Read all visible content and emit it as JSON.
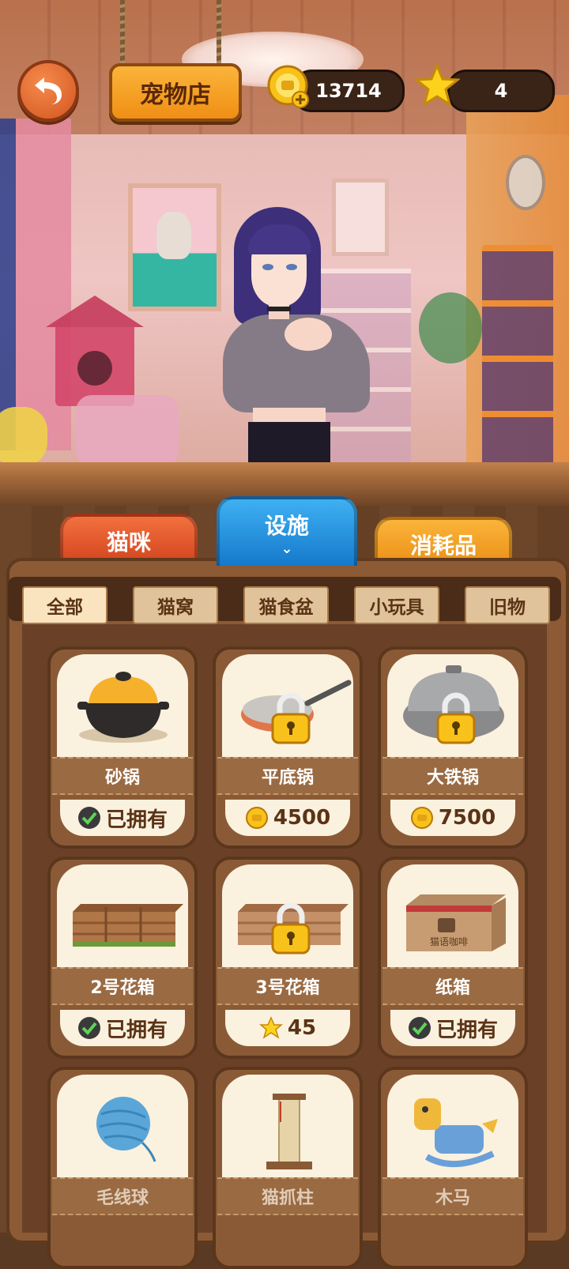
{
  "header": {
    "title": "宠物店",
    "coins": "13714",
    "stars": "4"
  },
  "tabs": {
    "cats": "猫咪",
    "facilities": "设施",
    "consumables": "消耗品",
    "active": "facilities"
  },
  "subtabs": [
    "全部",
    "猫窝",
    "猫食盆",
    "小玩具",
    "旧物"
  ],
  "items": [
    {
      "name": "砂锅",
      "status": "已拥有",
      "icon": "clay-pot-icon",
      "locked": false
    },
    {
      "name": "平底锅",
      "price": "4500",
      "currency": "coin",
      "icon": "frying-pan-icon",
      "locked": true
    },
    {
      "name": "大铁锅",
      "price": "7500",
      "currency": "coin",
      "icon": "iron-wok-icon",
      "locked": true
    },
    {
      "name": "2号花箱",
      "status": "已拥有",
      "icon": "planter-box-icon",
      "locked": false
    },
    {
      "name": "3号花箱",
      "price": "45",
      "currency": "star",
      "icon": "planter-box-icon",
      "locked": true
    },
    {
      "name": "纸箱",
      "status": "已拥有",
      "icon": "cardboard-box-icon",
      "locked": false,
      "box_text": "猫语咖啡"
    },
    {
      "name": "毛线球",
      "icon": "yarn-ball-icon"
    },
    {
      "name": "猫抓柱",
      "icon": "scratching-post-icon"
    },
    {
      "name": "木马",
      "icon": "rocking-horse-icon"
    }
  ]
}
